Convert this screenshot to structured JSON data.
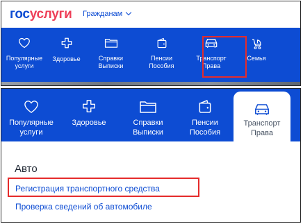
{
  "header": {
    "logo_part1": "гос",
    "logo_part2": "услуги",
    "menu_label": "Гражданам"
  },
  "categories_top": [
    {
      "icon": "heart-icon",
      "line1": "Популярные",
      "line2": "услуги"
    },
    {
      "icon": "medical-cross-icon",
      "line1": "Здоровье",
      "line2": ""
    },
    {
      "icon": "folder-icon",
      "line1": "Справки",
      "line2": "Выписки"
    },
    {
      "icon": "wallet-icon",
      "line1": "Пенсии",
      "line2": "Пособия"
    },
    {
      "icon": "car-icon",
      "line1": "Транспорт",
      "line2": "Права"
    },
    {
      "icon": "stroller-icon",
      "line1": "Семья",
      "line2": ""
    }
  ],
  "categories_bottom": [
    {
      "icon": "heart-icon",
      "line1": "Популярные",
      "line2": "услуги"
    },
    {
      "icon": "medical-cross-icon",
      "line1": "Здоровье",
      "line2": ""
    },
    {
      "icon": "folder-icon",
      "line1": "Справки",
      "line2": "Выписки"
    },
    {
      "icon": "wallet-icon",
      "line1": "Пенсии",
      "line2": "Пособия"
    },
    {
      "icon": "car-icon",
      "line1": "Транспорт",
      "line2": "Права",
      "active": true
    }
  ],
  "section": {
    "title": "Авто",
    "links": [
      "Регистрация транспортного средства",
      "Проверка сведений об автомобиле"
    ]
  },
  "colors": {
    "brand_blue": "#0d4cd3",
    "brand_red": "#ee3f58",
    "highlight": "#e52b2b"
  }
}
